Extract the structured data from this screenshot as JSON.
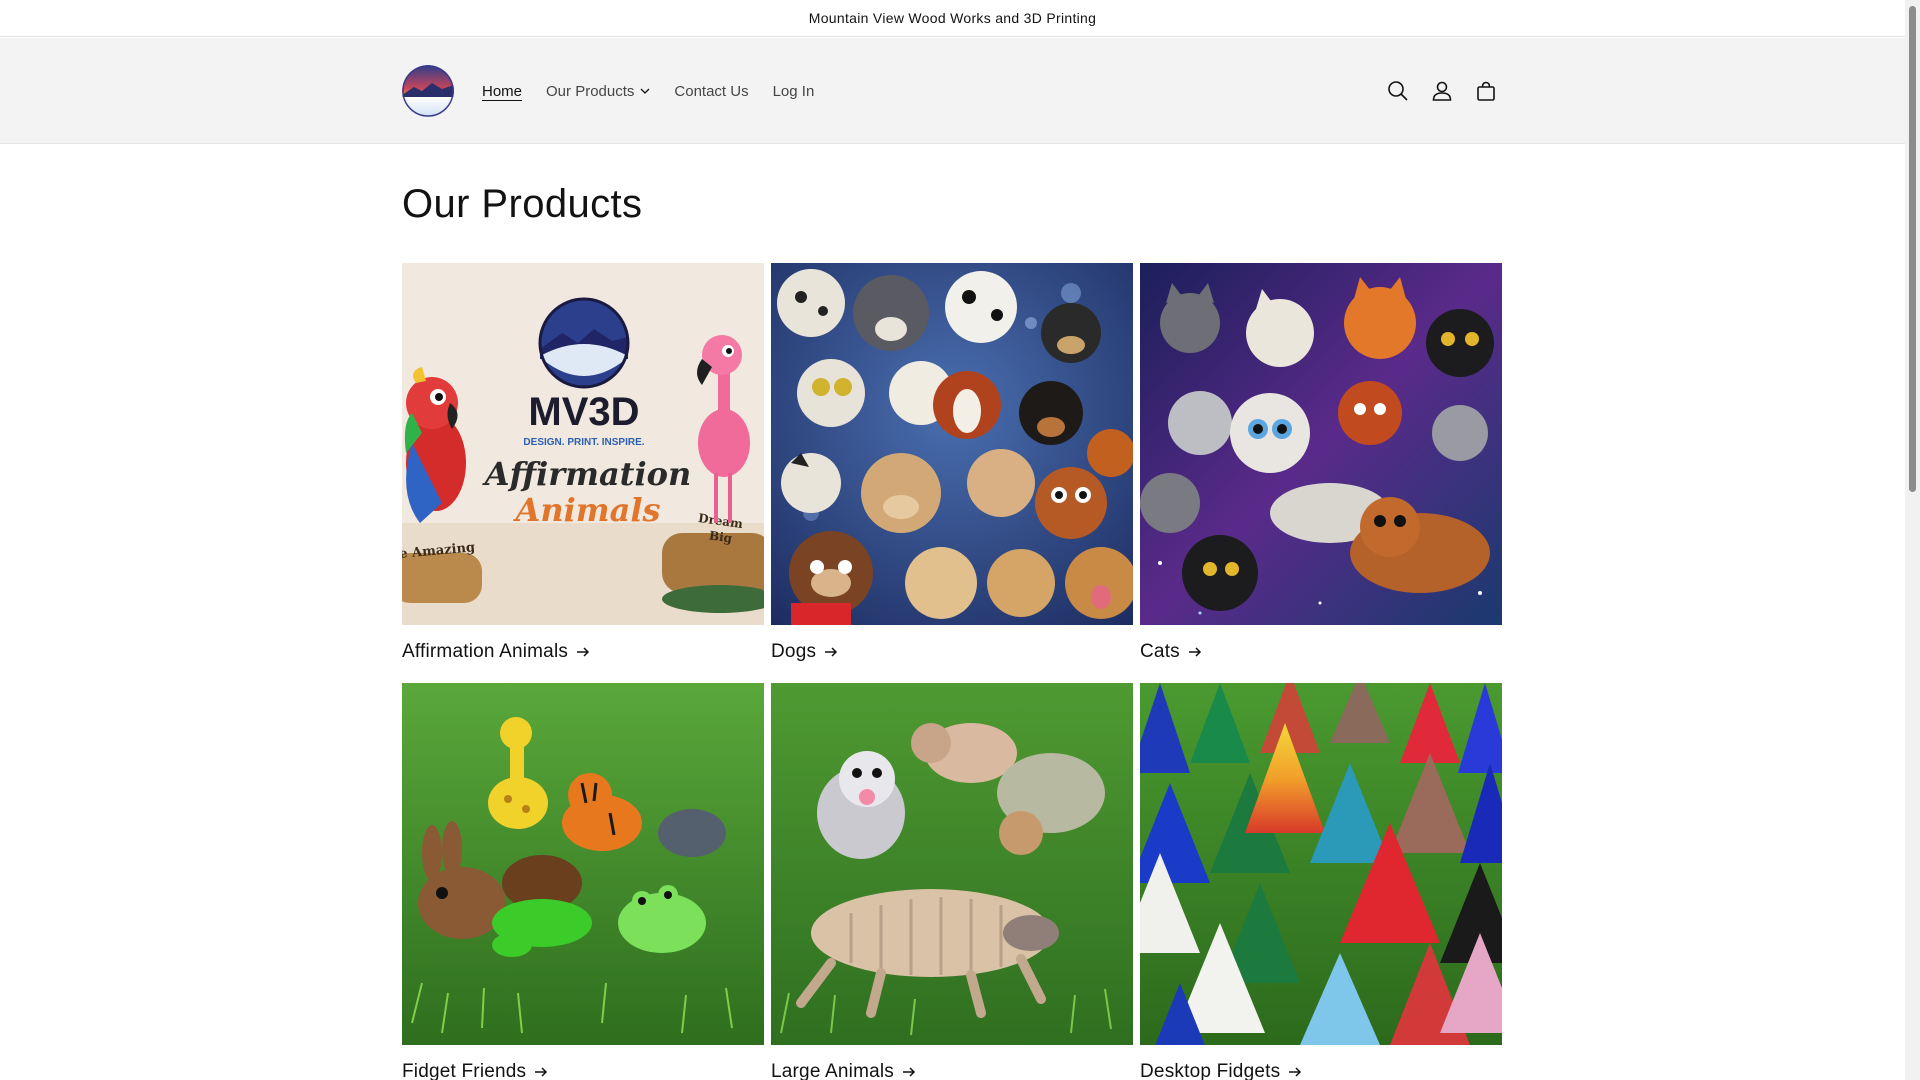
{
  "announcement": {
    "text": "Mountain View Wood Works and 3D Printing"
  },
  "header": {
    "logo_icon": "mountain-sunset-logo",
    "nav": [
      {
        "label": "Home",
        "active": true
      },
      {
        "label": "Our Products",
        "has_dropdown": true
      },
      {
        "label": "Contact Us"
      },
      {
        "label": "Log In"
      }
    ],
    "icons": [
      "search-icon",
      "account-icon",
      "cart-icon"
    ]
  },
  "main": {
    "title": "Our Products",
    "collections": [
      {
        "title": "Affirmation Animals",
        "image": "affirmation-animals-banner",
        "banner": {
          "brand": "MV3D",
          "tagline": "DESIGN. PRINT. INSPIRE.",
          "line1": "Affirmation",
          "line2": "Animals",
          "plaque_left": "Be Amazing",
          "plaque_right_1": "Dream",
          "plaque_right_2": "Big"
        }
      },
      {
        "title": "Dogs",
        "image": "dogs-collection-photo"
      },
      {
        "title": "Cats",
        "image": "cats-collection-photo"
      },
      {
        "title": "Fidget Friends",
        "image": "fidget-friends-photo"
      },
      {
        "title": "Large Animals",
        "image": "large-animals-photo"
      },
      {
        "title": "Desktop Fidgets",
        "image": "desktop-fidgets-photo"
      }
    ]
  },
  "colors": {
    "header_bg": "#f3f3f3",
    "text": "#121212",
    "grass": "#3f8a2a",
    "galaxy": "#2a2a6e"
  }
}
